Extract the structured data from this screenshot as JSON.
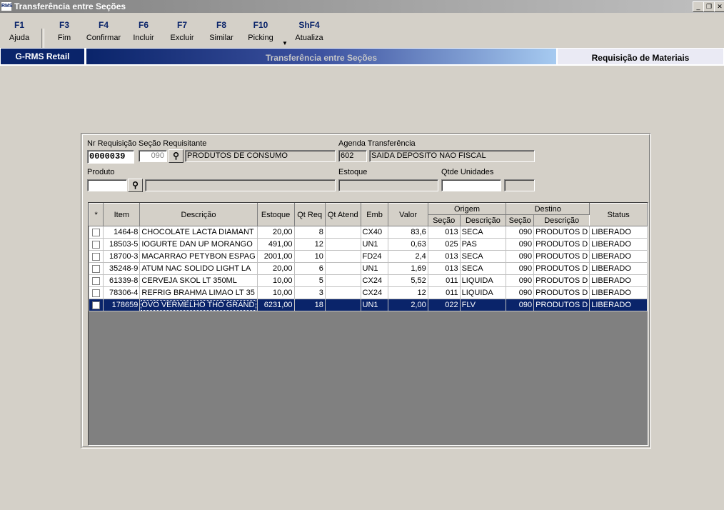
{
  "window": {
    "title": "Transferência entre Seções",
    "icon_text": "RMS"
  },
  "toolbar": [
    {
      "key": "F1",
      "label": "Ajuda"
    },
    {
      "key": "F3",
      "label": "Fim"
    },
    {
      "key": "F4",
      "label": "Confirmar"
    },
    {
      "key": "F6",
      "label": "Incluir"
    },
    {
      "key": "F7",
      "label": "Excluir"
    },
    {
      "key": "F8",
      "label": "Similar"
    },
    {
      "key": "F10",
      "label": "Picking"
    },
    {
      "key": "ShF4",
      "label": "Atualiza"
    }
  ],
  "banner": {
    "app": "G-RMS Retail",
    "screen": "Transferência entre Seções",
    "module": "Requisição de Materiais"
  },
  "form": {
    "nr_requisicao_label": "Nr Requisição",
    "nr_requisicao": "0000039",
    "secao_label": "Seção Requisitante",
    "secao_code": "090",
    "secao_desc": "PRODUTOS DE CONSUMO",
    "agenda_label": "Agenda Transferência",
    "agenda_code": "602",
    "agenda_desc": "SAIDA DEPOSITO NAO FISCAL",
    "produto_label": "Produto",
    "produto_code": "",
    "produto_desc": "",
    "estoque_label": "Estoque",
    "estoque": "",
    "qtde_label": "Qtde Unidades",
    "qtde": "",
    "qtde2": ""
  },
  "grid": {
    "headers": {
      "star": "*",
      "item": "Item",
      "descricao": "Descrição",
      "estoque": "Estoque",
      "qt_req": "Qt Req",
      "qt_atend": "Qt Atend",
      "emb": "Emb",
      "valor": "Valor",
      "origem": "Origem",
      "destino": "Destino",
      "secao": "Seção",
      "descricao_sub": "Descrição",
      "status": "Status"
    },
    "rows": [
      {
        "item": "1464-8",
        "descricao": "CHOCOLATE LACTA DIAMANT",
        "estoque": "20,00",
        "qt_req": "8",
        "qt_atend": "",
        "emb": "CX40",
        "valor": "83,6",
        "orig_secao": "013",
        "orig_desc": "SECA",
        "dest_secao": "090",
        "dest_desc": "PRODUTOS D",
        "status": "LIBERADO"
      },
      {
        "item": "18503-5",
        "descricao": "IOGURTE DAN UP MORANGO",
        "estoque": "491,00",
        "qt_req": "12",
        "qt_atend": "",
        "emb": "UN1",
        "valor": "0,63",
        "orig_secao": "025",
        "orig_desc": "PAS",
        "dest_secao": "090",
        "dest_desc": "PRODUTOS D",
        "status": "LIBERADO"
      },
      {
        "item": "18700-3",
        "descricao": "MACARRAO PETYBON ESPAG",
        "estoque": "2001,00",
        "qt_req": "10",
        "qt_atend": "",
        "emb": "FD24",
        "valor": "2,4",
        "orig_secao": "013",
        "orig_desc": "SECA",
        "dest_secao": "090",
        "dest_desc": "PRODUTOS D",
        "status": "LIBERADO"
      },
      {
        "item": "35248-9",
        "descricao": "ATUM NAC SOLIDO LIGHT LA",
        "estoque": "20,00",
        "qt_req": "6",
        "qt_atend": "",
        "emb": "UN1",
        "valor": "1,69",
        "orig_secao": "013",
        "orig_desc": "SECA",
        "dest_secao": "090",
        "dest_desc": "PRODUTOS D",
        "status": "LIBERADO"
      },
      {
        "item": "61339-8",
        "descricao": "CERVEJA SKOL LT 350ML",
        "estoque": "10,00",
        "qt_req": "5",
        "qt_atend": "",
        "emb": "CX24",
        "valor": "5,52",
        "orig_secao": "011",
        "orig_desc": "LIQUIDA",
        "dest_secao": "090",
        "dest_desc": "PRODUTOS D",
        "status": "LIBERADO"
      },
      {
        "item": "78306-4",
        "descricao": "REFRIG BRAHMA LIMAO LT 35",
        "estoque": "10,00",
        "qt_req": "3",
        "qt_atend": "",
        "emb": "CX24",
        "valor": "12",
        "orig_secao": "011",
        "orig_desc": "LIQUIDA",
        "dest_secao": "090",
        "dest_desc": "PRODUTOS D",
        "status": "LIBERADO"
      },
      {
        "item": "178659",
        "descricao": "OVO VERMELHO THO GRAND",
        "estoque": "6231,00",
        "qt_req": "18",
        "qt_atend": "",
        "emb": "UN1",
        "valor": "2,00",
        "orig_secao": "022",
        "orig_desc": "FLV",
        "dest_secao": "090",
        "dest_desc": "PRODUTOS D",
        "status": "LIBERADO",
        "selected": true
      }
    ]
  }
}
